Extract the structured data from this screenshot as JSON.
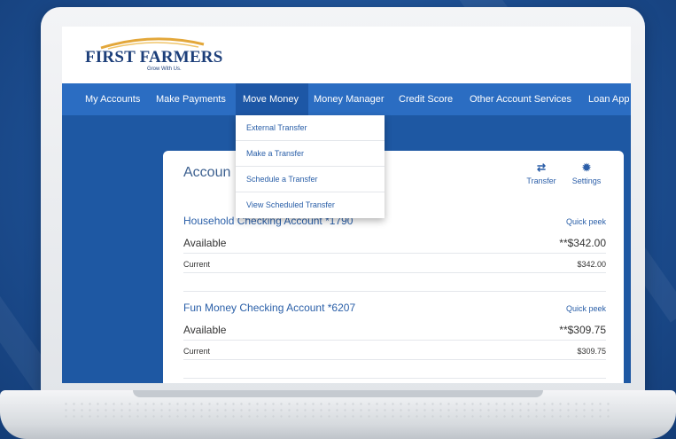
{
  "brand": {
    "name": "FIRST FARMERS",
    "tagline": "Grow With Us."
  },
  "nav": {
    "items": [
      {
        "label": "My Accounts"
      },
      {
        "label": "Make Payments"
      },
      {
        "label": "Move Money",
        "active": true
      },
      {
        "label": "Money Manager"
      },
      {
        "label": "Credit Score"
      },
      {
        "label": "Other Account Services"
      },
      {
        "label": "Loan App"
      }
    ]
  },
  "move_money_menu": {
    "items": [
      {
        "label": "External Transfer"
      },
      {
        "label": "Make a Transfer"
      },
      {
        "label": "Schedule a Transfer"
      },
      {
        "label": "View Scheduled Transfer"
      }
    ]
  },
  "accounts_panel": {
    "title": "Accoun",
    "tools": [
      {
        "label": "Transfer",
        "icon": "transfer-arrows-icon",
        "glyph": "⇄"
      },
      {
        "label": "Settings",
        "icon": "gear-icon",
        "glyph": "✹"
      }
    ],
    "accounts": [
      {
        "name": "Household Checking Account  *1790",
        "quick_peek": "Quick peek",
        "available_label": "Available",
        "available_value": "**$342.00",
        "current_label": "Current",
        "current_value": "$342.00"
      },
      {
        "name": "Fun Money Checking Account  *6207",
        "quick_peek": "Quick peek",
        "available_label": "Available",
        "available_value": "**$309.75",
        "current_label": "Current",
        "current_value": "$309.75"
      }
    ]
  },
  "colors": {
    "nav_bg": "#2b6dc2",
    "nav_active": "#1d57a6",
    "link_blue": "#2a5fa8",
    "brand_navy": "#1d3f7a",
    "logo_gold": "#e3a73a"
  }
}
